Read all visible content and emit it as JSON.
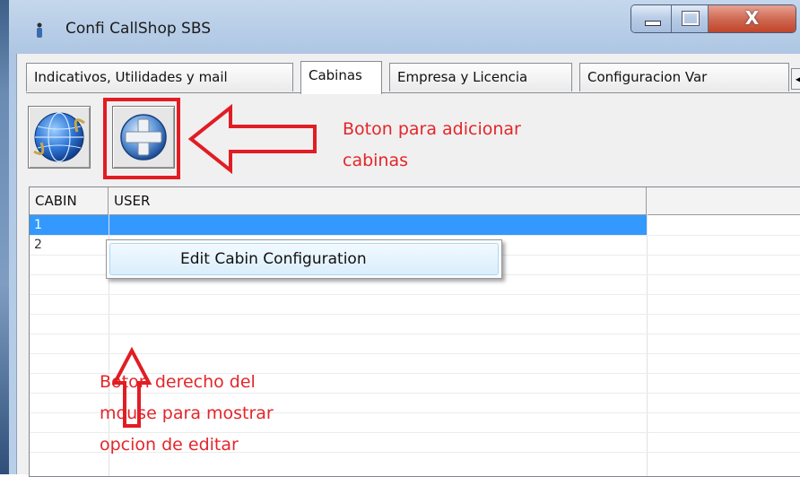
{
  "window": {
    "title": "Confi CallShop SBS",
    "close_glyph": "X"
  },
  "tabs": [
    {
      "label": "Indicativos, Utilidades y mail",
      "active": false
    },
    {
      "label": "Cabinas",
      "active": true
    },
    {
      "label": "Empresa y Licencia",
      "active": false
    },
    {
      "label": "Configuracion Var",
      "active": false
    }
  ],
  "tab_scroll": {
    "left": "◀",
    "right": "▶"
  },
  "toolbar": {
    "globe_icon": "globe-icon",
    "add_icon": "plus-circle-icon"
  },
  "annotations": {
    "add_button": [
      "Boton para adicionar",
      "cabinas"
    ],
    "right_click": [
      "Boton derecho del",
      "mouse para mostrar",
      "opcion de editar"
    ]
  },
  "grid": {
    "columns": [
      "CABIN",
      "USER"
    ],
    "rows": [
      {
        "cabin": "1",
        "user": "",
        "selected": true
      },
      {
        "cabin": "2",
        "user": "",
        "selected": false
      }
    ]
  },
  "context_menu": {
    "items": [
      "Edit Cabin Configuration"
    ]
  },
  "colors": {
    "annotation": "#e3262b",
    "selection": "#3399ff"
  }
}
